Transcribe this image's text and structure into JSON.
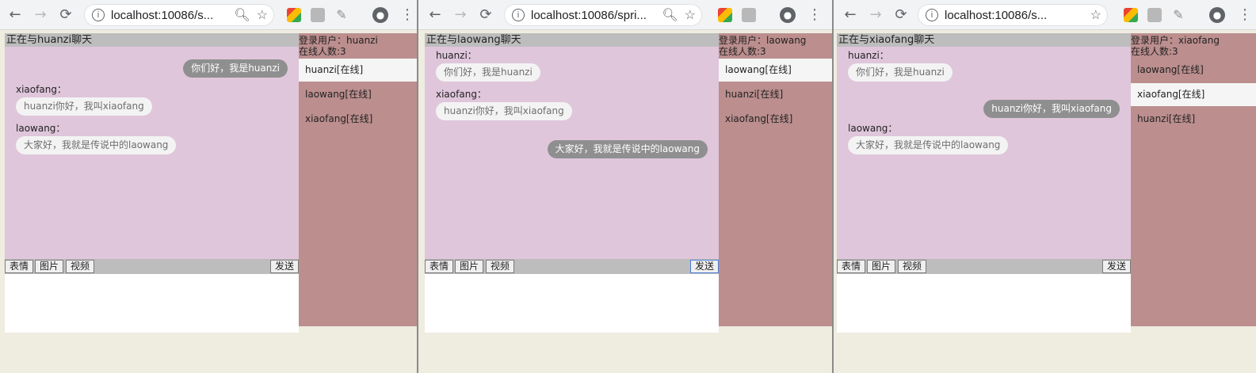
{
  "browser": {
    "url_1": "localhost:10086/s...",
    "url_2": "localhost:10086/spri...",
    "url_3": "localhost:10086/s..."
  },
  "windows": [
    {
      "chat_header": "正在与huanzi聊天",
      "login_user": "登录用户：huanzi",
      "online_count": "在线人数:3",
      "users": [
        {
          "label": "huanzi[在线]",
          "active": true
        },
        {
          "label": "laowang[在线]",
          "active": false
        },
        {
          "label": "xiaofang[在线]",
          "active": false
        }
      ],
      "messages": [
        {
          "self": true,
          "sender": "",
          "text": "你们好，我是huanzi"
        },
        {
          "self": false,
          "sender": "xiaofang：",
          "text": "huanzi你好，我叫xiaofang"
        },
        {
          "self": false,
          "sender": "laowang：",
          "text": "大家好，我就是传说中的laowang"
        }
      ]
    },
    {
      "chat_header": "正在与laowang聊天",
      "login_user": "登录用户：laowang",
      "online_count": "在线人数:3",
      "users": [
        {
          "label": "laowang[在线]",
          "active": true
        },
        {
          "label": "huanzi[在线]",
          "active": false
        },
        {
          "label": "xiaofang[在线]",
          "active": false
        }
      ],
      "messages": [
        {
          "self": false,
          "sender": "huanzi：",
          "text": "你们好，我是huanzi"
        },
        {
          "self": false,
          "sender": "xiaofang：",
          "text": "huanzi你好，我叫xiaofang"
        },
        {
          "self": true,
          "sender": "",
          "text": "大家好，我就是传说中的laowang"
        }
      ]
    },
    {
      "chat_header": "正在与xiaofang聊天",
      "login_user": "登录用户：xiaofang",
      "online_count": "在线人数:3",
      "users": [
        {
          "label": "laowang[在线]",
          "active": false
        },
        {
          "label": "xiaofang[在线]",
          "active": true
        },
        {
          "label": "huanzi[在线]",
          "active": false
        }
      ],
      "messages": [
        {
          "self": false,
          "sender": "huanzi：",
          "text": "你们好，我是huanzi"
        },
        {
          "self": true,
          "sender": "",
          "text": "huanzi你好，我叫xiaofang"
        },
        {
          "self": false,
          "sender": "laowang：",
          "text": "大家好，我就是传说中的laowang"
        }
      ]
    }
  ],
  "toolbar": {
    "emoji": "表情",
    "image": "图片",
    "video": "视频",
    "send": "发送"
  },
  "icons": {
    "back": "back-arrow-icon",
    "forward": "forward-arrow-icon",
    "reload": "reload-icon",
    "info": "info-icon",
    "zoom": "zoom-icon",
    "star": "star-icon",
    "profile": "profile-icon",
    "menu": "menu-icon"
  }
}
